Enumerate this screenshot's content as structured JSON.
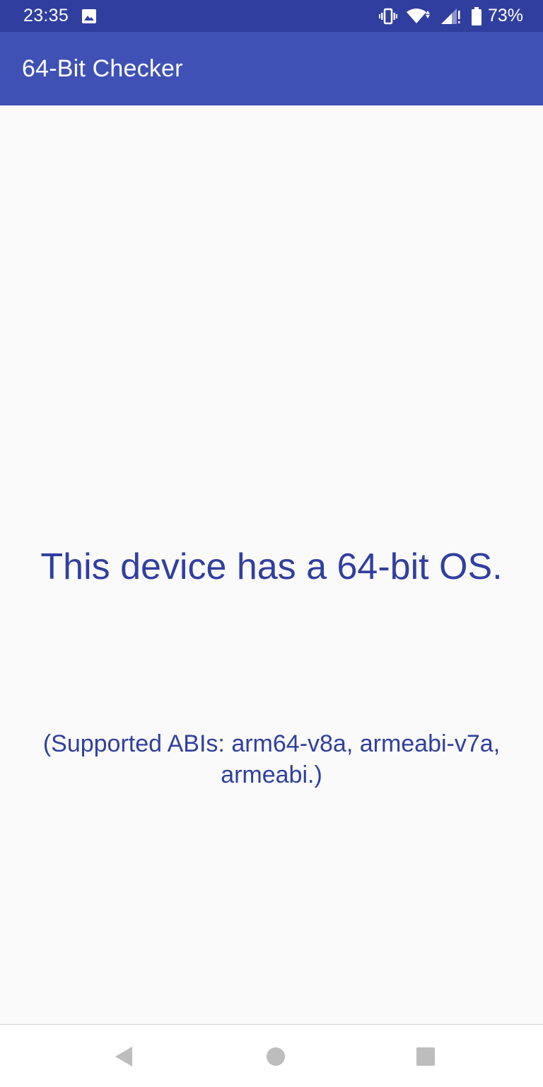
{
  "status_bar": {
    "time": "23:35",
    "battery_percent": "73%",
    "icons": [
      "image-icon",
      "vibrate-icon",
      "wifi-icon",
      "signal-icon",
      "battery-icon"
    ]
  },
  "app_bar": {
    "title": "64-Bit Checker"
  },
  "main": {
    "message": "This device has a 64-bit OS.",
    "abi_text": "(Supported ABIs: arm64-v8a, armeabi-v7a, armeabi.)"
  },
  "nav_bar": {
    "icons": [
      "back-icon",
      "home-icon",
      "recents-icon"
    ]
  },
  "colors": {
    "status_bar": "#303f9f",
    "app_bar": "#3f51b5",
    "text_accent": "#303f9f",
    "background": "#fafafa"
  }
}
